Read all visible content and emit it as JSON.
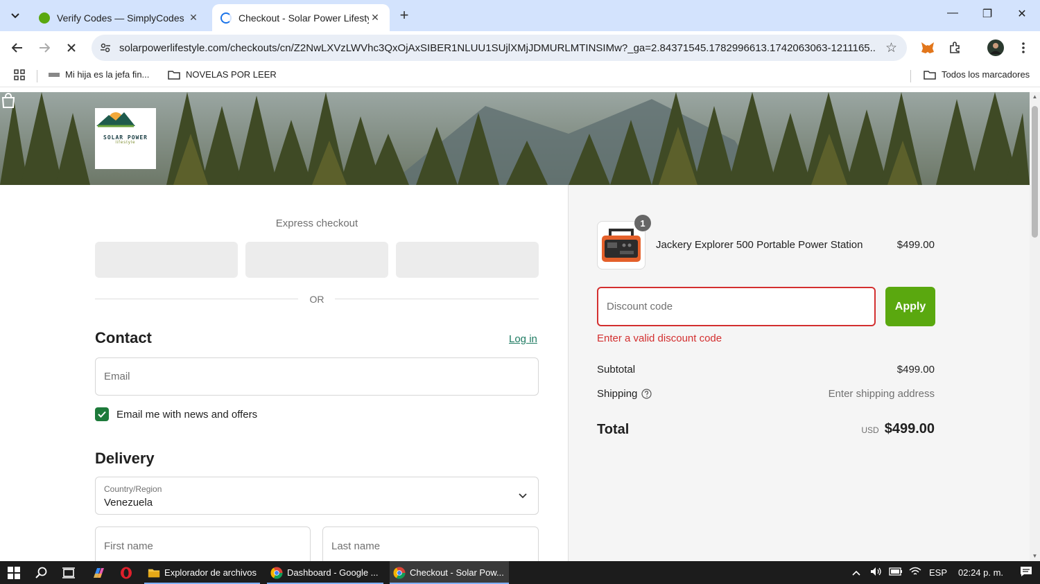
{
  "browser": {
    "tabs": [
      {
        "title": "Verify Codes — SimplyCodes",
        "active": false,
        "favicon_color": "#5aa80f"
      },
      {
        "title": "Checkout - Solar Power Lifestyle",
        "active": true,
        "favicon_color": "#1a73e8"
      }
    ],
    "url": "solarpowerlifestyle.com/checkouts/cn/Z2NwLXVzLWVhc3QxOjAxSIBER1NLUU1SUjlXMjJDMURLMTINSIMw?_ga=2.84371545.1782996613.1742063063-1211165...",
    "bookmarks": [
      {
        "label": "Mi hija es la jefa fin..."
      },
      {
        "label": "NOVELAS POR LEER"
      }
    ],
    "all_bookmarks_label": "Todos los marcadores"
  },
  "store": {
    "logo_title": "SOLAR POWER",
    "logo_subtitle": "lifestyle"
  },
  "checkout": {
    "express_title": "Express checkout",
    "or_text": "OR",
    "contact_heading": "Contact",
    "login_label": "Log in",
    "email_placeholder": "Email",
    "newsletter_label": "Email me with news and offers",
    "newsletter_checked": true,
    "delivery_heading": "Delivery",
    "country_label": "Country/Region",
    "country_value": "Venezuela",
    "first_name_placeholder": "First name",
    "last_name_placeholder": "Last name"
  },
  "summary": {
    "item_name": "Jackery Explorer 500 Portable Power Station",
    "item_price": "$499.00",
    "item_qty": "1",
    "discount_placeholder": "Discount code",
    "apply_label": "Apply",
    "discount_error": "Enter a valid discount code",
    "subtotal_label": "Subtotal",
    "subtotal_value": "$499.00",
    "shipping_label": "Shipping",
    "shipping_value": "Enter shipping address",
    "total_label": "Total",
    "total_currency": "USD",
    "total_value": "$499.00",
    "accent_color": "#5aa80f",
    "error_color": "#d32f2f"
  },
  "taskbar": {
    "apps": [
      {
        "label": "Explorador de archivos"
      },
      {
        "label": "Dashboard - Google ..."
      },
      {
        "label": "Checkout - Solar Pow..."
      }
    ],
    "language": "ESP",
    "time": "02:24 p. m."
  }
}
